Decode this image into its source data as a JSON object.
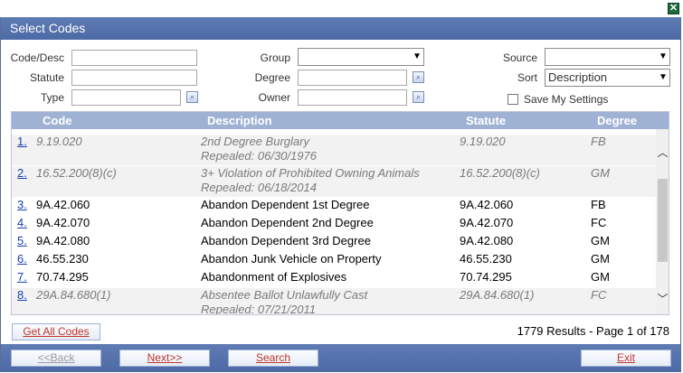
{
  "window": {
    "title": "Select Codes"
  },
  "filters": {
    "code_desc_label": "Code/Desc",
    "statute_label": "Statute",
    "type_label": "Type",
    "group_label": "Group",
    "degree_label": "Degree",
    "owner_label": "Owner",
    "source_label": "Source",
    "sort_label": "Sort",
    "sort_value": "Description",
    "save_settings_label": "Save My Settings"
  },
  "table": {
    "columns": {
      "code": "Code",
      "description": "Description",
      "statute": "Statute",
      "degree": "Degree"
    },
    "rows": [
      {
        "num": "1.",
        "code": "9.19.020",
        "description": "2nd Degree Burglary",
        "sub": "Repealed: 06/30/1976",
        "statute": "9.19.020",
        "degree": "FB"
      },
      {
        "num": "2.",
        "code": "16.52.200(8)(c)",
        "description": "3+ Violation of Prohibited Owning Animals",
        "sub": "Repealed: 06/18/2014",
        "statute": "16.52.200(8)(c)",
        "degree": "GM"
      },
      {
        "num": "3.",
        "code": "9A.42.060",
        "description": "Abandon Dependent 1st Degree",
        "statute": "9A.42.060",
        "degree": "FB"
      },
      {
        "num": "4.",
        "code": "9A.42.070",
        "description": "Abandon Dependent 2nd Degree",
        "statute": "9A.42.070",
        "degree": "FC"
      },
      {
        "num": "5.",
        "code": "9A.42.080",
        "description": "Abandon Dependent 3rd Degree",
        "statute": "9A.42.080",
        "degree": "GM"
      },
      {
        "num": "6.",
        "code": "46.55.230",
        "description": "Abandon Junk Vehicle on Property",
        "statute": "46.55.230",
        "degree": "GM"
      },
      {
        "num": "7.",
        "code": "70.74.295",
        "description": "Abandonment of Explosives",
        "statute": "70.74.295",
        "degree": "GM"
      },
      {
        "num": "8.",
        "code": "29A.84.680(1)",
        "description": "Absentee Ballot Unlawfully Cast",
        "sub": "Repealed: 07/21/2011",
        "statute": "29A.84.680(1)",
        "degree": "FC"
      }
    ]
  },
  "actions": {
    "get_all_codes": "Get All Codes",
    "results_text": "1779 Results - Page 1 of 178",
    "back": "<<Back",
    "next": "Next>>",
    "search": "Search",
    "exit": "Exit"
  },
  "icons": {
    "close": "close-icon",
    "lookup": "lookup-icon",
    "dropdown": "chevron-down-icon"
  }
}
